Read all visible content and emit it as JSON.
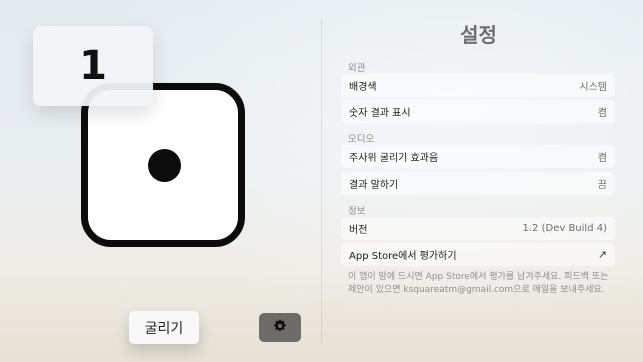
{
  "dice": {
    "result": "1",
    "roll_label": "굴리기",
    "settings_icon": "gear-icon"
  },
  "settings": {
    "title": "설정",
    "sections": [
      {
        "header": "외관",
        "rows": [
          {
            "label": "배경색",
            "value": "시스템"
          },
          {
            "label": "숫자 결과 표시",
            "value": "켬"
          }
        ]
      },
      {
        "header": "오디오",
        "rows": [
          {
            "label": "주사위 굴리기 효과음",
            "value": "켬"
          },
          {
            "label": "결과 말하기",
            "value": "끔"
          }
        ]
      },
      {
        "header": "정보",
        "rows": [
          {
            "label": "버전",
            "value": "1.2 (Dev Build 4)"
          },
          {
            "label": "App Store에서 평가하기",
            "value": "↗"
          }
        ]
      }
    ],
    "footer": "이 앱이 맘에 드시면 App Store에서 평가를 남겨주세요. 피드백 또는 제안이 있으면 ksquareatm@gmail.com으로 메일을 보내주세요."
  },
  "colors": {
    "die_fill": "#ffffff",
    "die_ink": "#0c0c0c",
    "settings_button": "#6e6b68"
  }
}
